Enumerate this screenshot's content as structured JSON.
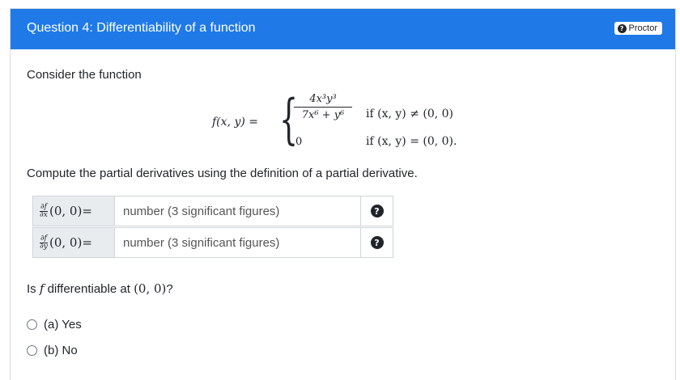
{
  "header": {
    "title": "Question 4: Differentiability of a function",
    "proctor_label": "Proctor",
    "proctor_icon": "question-circle-icon",
    "color": "#1f7ae8"
  },
  "intro": "Consider the function",
  "formula": {
    "lhs": "f(x, y) =",
    "brace": "{",
    "numerator": "4x³y³",
    "denominator": "7x⁶ + y⁶",
    "zero": "0",
    "condition1": "if (x, y) ≠ (0, 0)",
    "condition2": "if (x, y) = (0, 0)."
  },
  "instruction": "Compute the partial derivatives using the definition of a partial derivative.",
  "inputs": [
    {
      "numerator": "∂f",
      "denominator": "∂x",
      "point": "(0, 0)=",
      "placeholder": "number (3 significant figures)",
      "value": ""
    },
    {
      "numerator": "∂f",
      "denominator": "∂y",
      "point": "(0, 0)=",
      "placeholder": "number (3 significant figures)",
      "value": ""
    }
  ],
  "question": {
    "prefix": "Is",
    "var": "f",
    "middle": "differentiable at",
    "point": "(0, 0)",
    "suffix": "?"
  },
  "options": [
    {
      "label": "(a) Yes",
      "selected": false
    },
    {
      "label": "(b) No",
      "selected": false
    }
  ]
}
